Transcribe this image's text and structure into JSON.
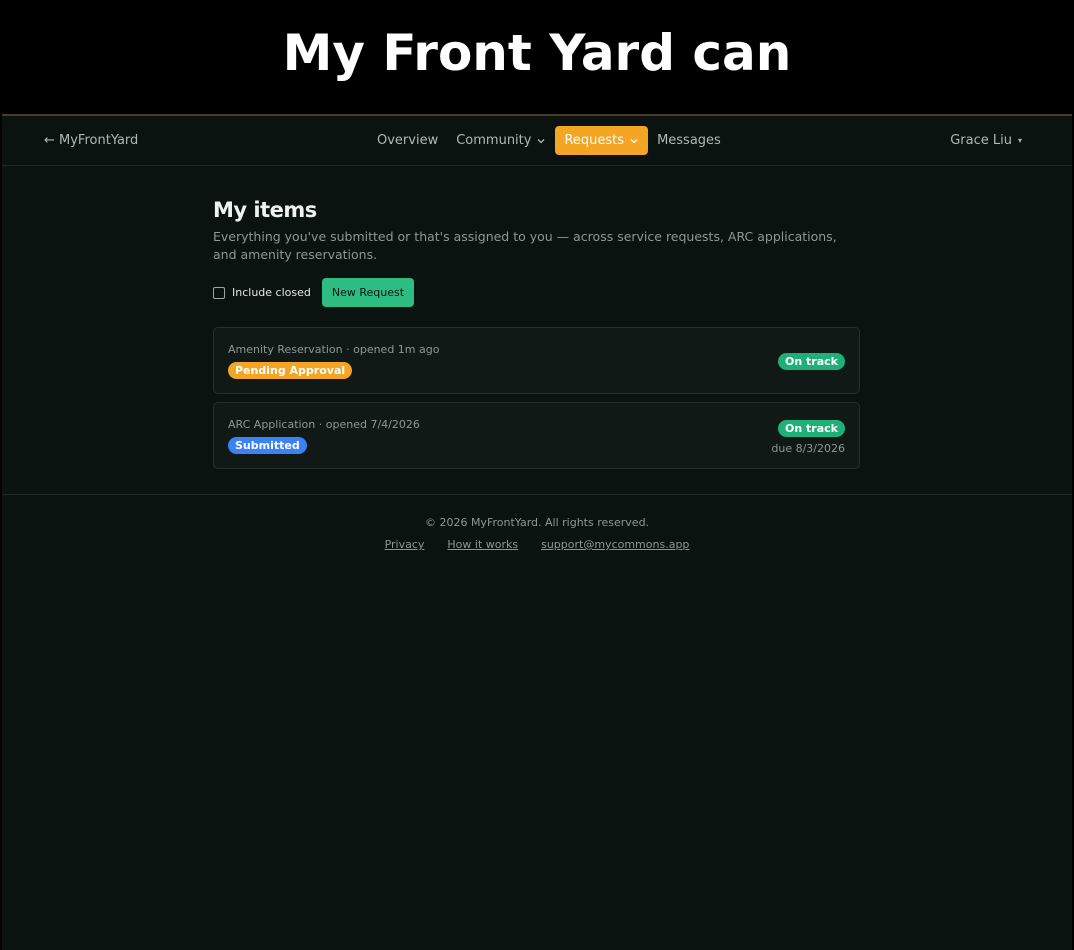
{
  "caption": "My Front Yard can",
  "nav": {
    "brand": "← MyFrontYard",
    "items": [
      {
        "label": "Overview",
        "dropdown": false,
        "active": false
      },
      {
        "label": "Community",
        "dropdown": true,
        "active": false
      },
      {
        "label": "Requests",
        "dropdown": true,
        "active": true
      },
      {
        "label": "Messages",
        "dropdown": false,
        "active": false
      }
    ],
    "user": "Grace Liu"
  },
  "page": {
    "title": "My items",
    "subtitle": "Everything you've submitted or that's assigned to you — across service requests, ARC applications, and amenity reservations.",
    "include_closed_label": "Include closed",
    "new_request_label": "New Request"
  },
  "items": [
    {
      "meta": "Amenity Reservation · opened 1m ago",
      "status": "Pending Approval",
      "status_color": "#f5a524",
      "track": "On track",
      "due": ""
    },
    {
      "meta": "ARC Application · opened 7/4/2026",
      "status": "Submitted",
      "status_color": "#3b82f6",
      "track": "On track",
      "due": "due 8/3/2026"
    }
  ],
  "footer": {
    "copyright": "© 2026 MyFrontYard. All rights reserved.",
    "links": [
      "Privacy",
      "How it works",
      "support@mycommons.app"
    ]
  },
  "colors": {
    "accent": "#f5a524",
    "success": "#1fb07a",
    "button": "#2dbd82",
    "background": "#0b1311"
  }
}
